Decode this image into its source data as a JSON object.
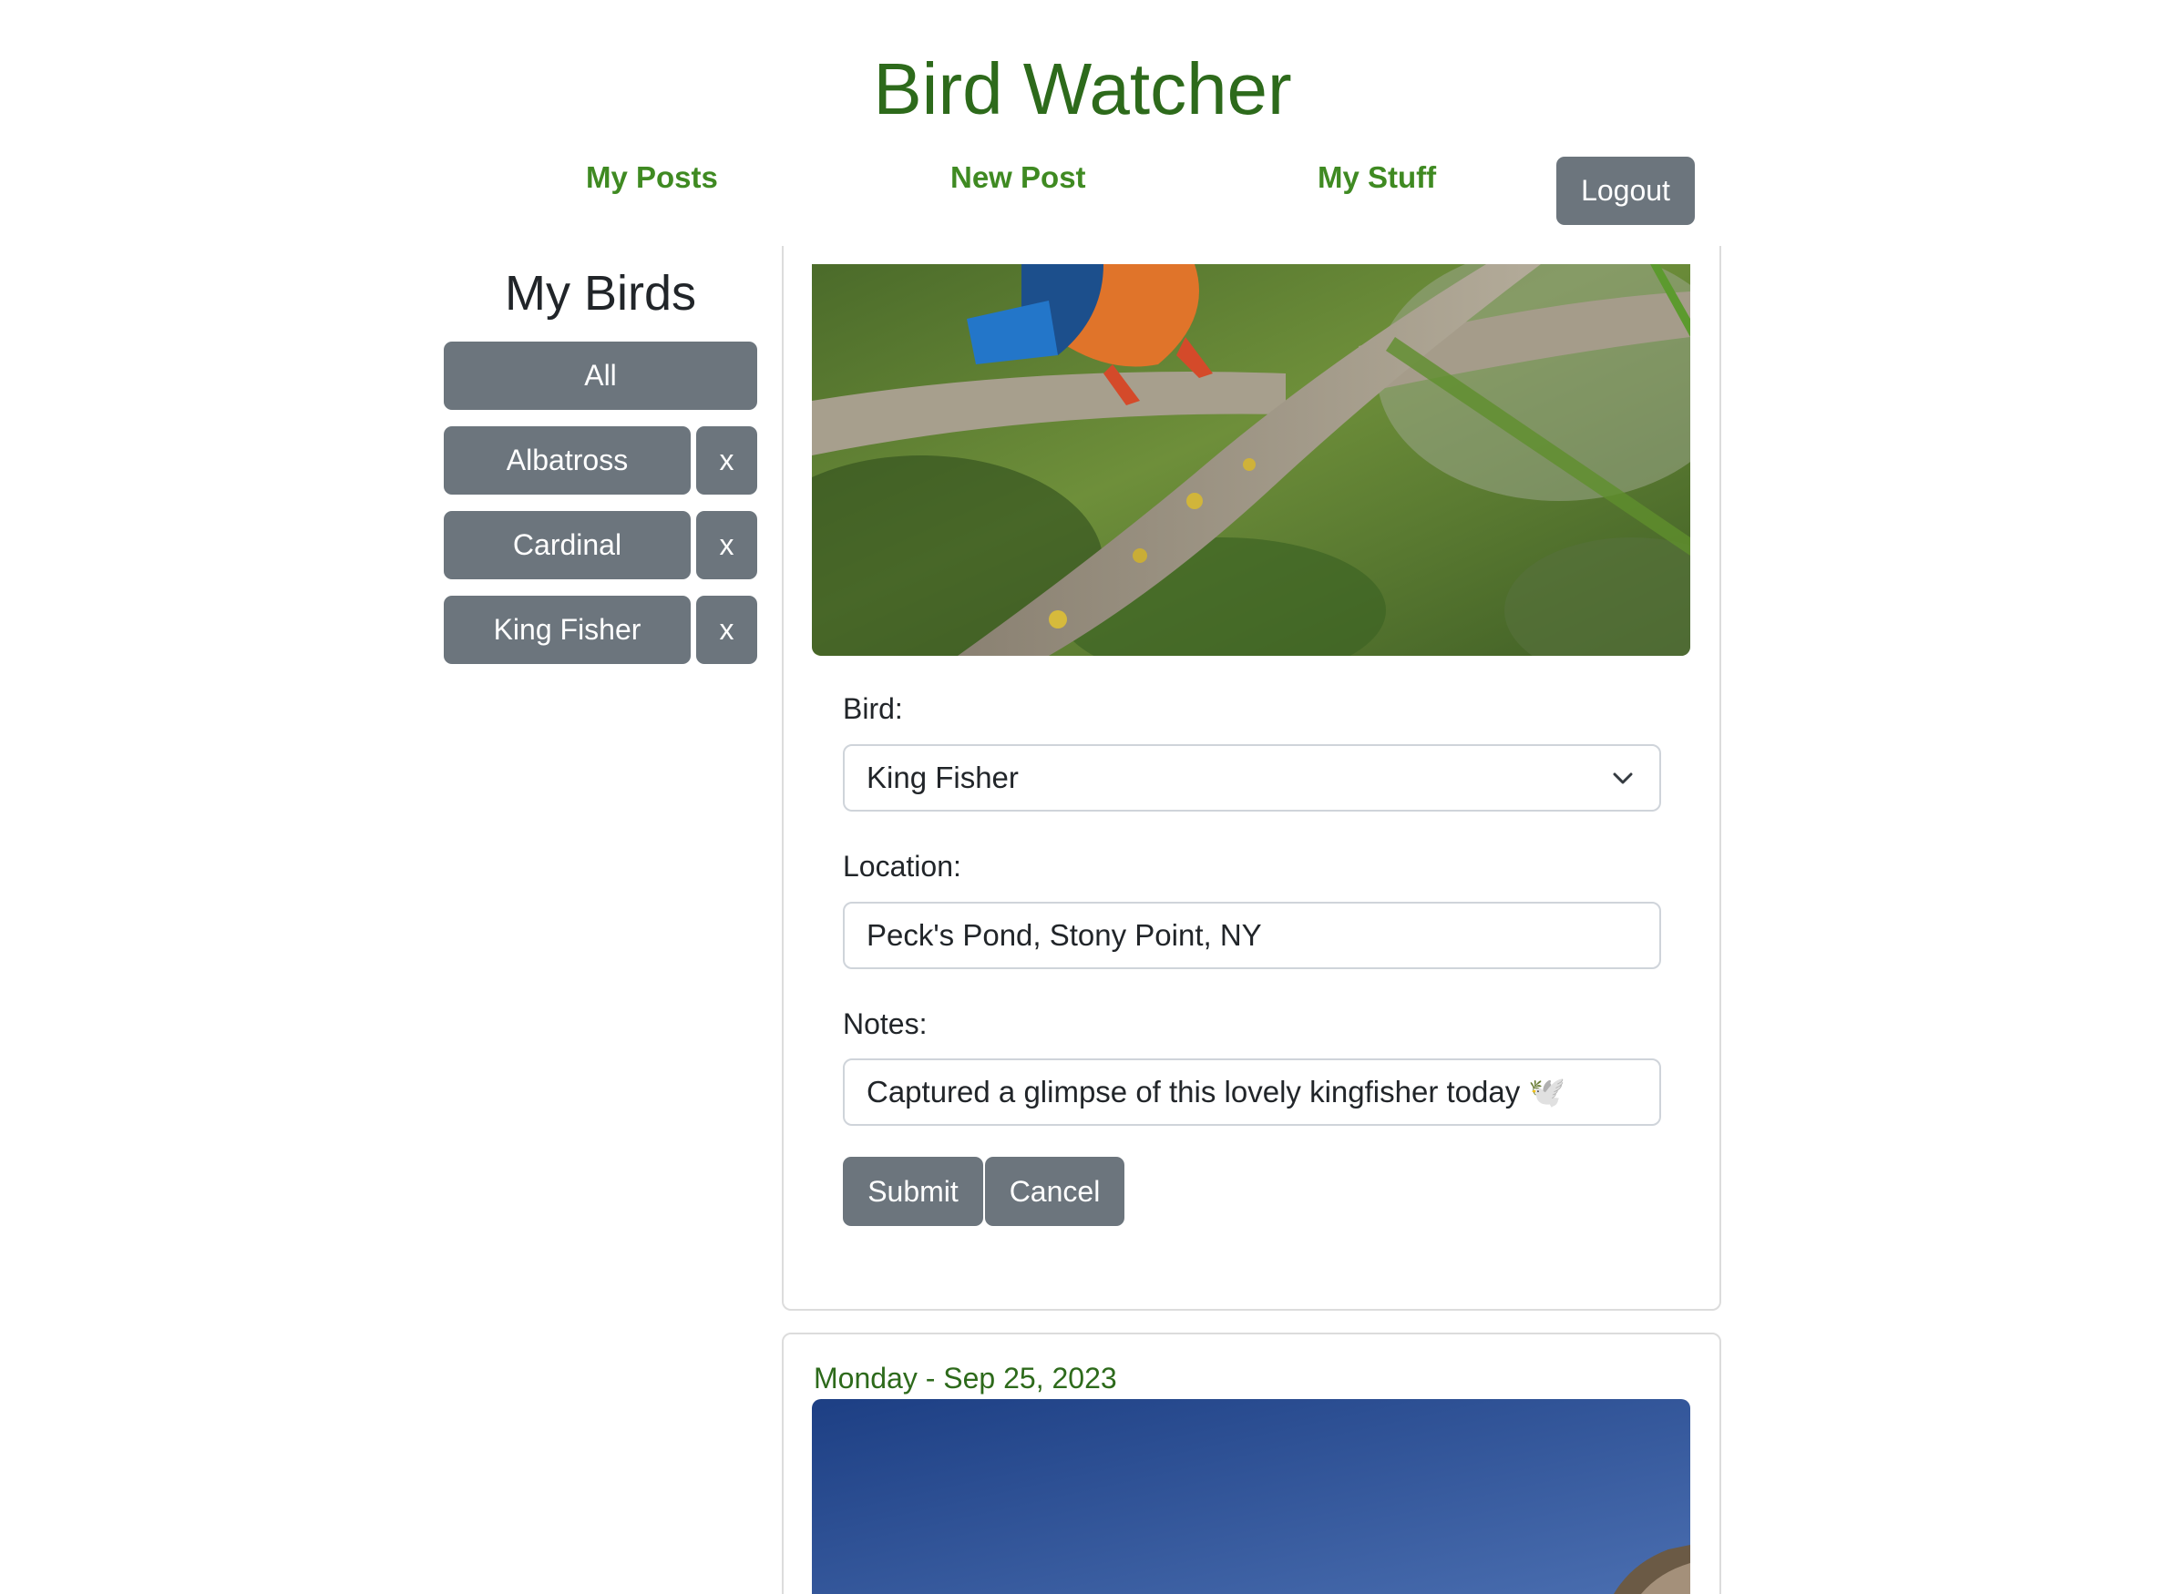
{
  "header": {
    "title": "Bird Watcher",
    "nav": [
      "My Posts",
      "New Post",
      "My Stuff"
    ],
    "logout_label": "Logout"
  },
  "sidebar": {
    "title": "My Birds",
    "all_label": "All",
    "birds": [
      {
        "label": "Albatross",
        "remove_label": "x"
      },
      {
        "label": "Cardinal",
        "remove_label": "x"
      },
      {
        "label": "King Fisher",
        "remove_label": "x"
      }
    ]
  },
  "edit_form": {
    "bird_label": "Bird:",
    "bird_value": "King Fisher",
    "location_label": "Location:",
    "location_value": "Peck's Pond, Stony Point, NY",
    "notes_label": "Notes:",
    "notes_value": "Captured a glimpse of this lovely kingfisher today 🕊️",
    "submit_label": "Submit",
    "cancel_label": "Cancel"
  },
  "posts": [
    {
      "date": "Monday - Sep 25, 2023"
    }
  ],
  "colors": {
    "brand_green": "#2d6a1b",
    "nav_green": "#3f8a22",
    "button_gray": "#6c757d"
  }
}
